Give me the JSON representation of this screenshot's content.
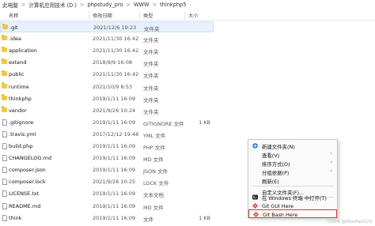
{
  "breadcrumb": [
    "此电脑",
    "计算机应用技术 (D:)",
    "phpstudy_pro",
    "WWW",
    "thinkphp5"
  ],
  "breadcrumb_sep": ">",
  "columns": {
    "name": "名称",
    "date": "修改日期",
    "type": "类型",
    "size": "大小"
  },
  "files": [
    {
      "name": ".git",
      "date": "2021/12/6 19:23",
      "type": "文件夹",
      "size": "",
      "icon": "folder-icon"
    },
    {
      "name": ".idea",
      "date": "2021/11/30 16:42",
      "type": "文件夹",
      "size": "",
      "icon": "folder-icon"
    },
    {
      "name": "application",
      "date": "2021/11/30 16:42",
      "type": "文件夹",
      "size": "",
      "icon": "folder-icon"
    },
    {
      "name": "extend",
      "date": "2018/9/9 16:08",
      "type": "文件夹",
      "size": "",
      "icon": "folder-icon"
    },
    {
      "name": "public",
      "date": "2021/11/30 16:42",
      "type": "文件夹",
      "size": "",
      "icon": "folder-icon"
    },
    {
      "name": "runtime",
      "date": "2021/10/9 8:53",
      "type": "文件夹",
      "size": "",
      "icon": "folder-icon"
    },
    {
      "name": "thinkphp",
      "date": "2019/1/11 16:09",
      "type": "文件夹",
      "size": "",
      "icon": "folder-icon"
    },
    {
      "name": "vendor",
      "date": "2021/9/26 10:24",
      "type": "文件夹",
      "size": "",
      "icon": "folder-icon"
    },
    {
      "name": ".gitignore",
      "date": "2019/1/11 16:09",
      "type": "GITIGNORE 文件",
      "size": "1 KB",
      "icon": "file-icon"
    },
    {
      "name": ".travis.yml",
      "date": "2017/12/12 19:48",
      "type": "YML 文件",
      "size": "",
      "icon": "file-icon"
    },
    {
      "name": "build.php",
      "date": "2019/1/11 16:09",
      "type": "PHP 文件",
      "size": "",
      "icon": "file-icon"
    },
    {
      "name": "CHANGELOG.md",
      "date": "2019/1/11 16:09",
      "type": "MD 文件",
      "size": "",
      "icon": "file-icon"
    },
    {
      "name": "composer.json",
      "date": "2019/1/11 16:09",
      "type": "JSON 文件",
      "size": "",
      "icon": "file-icon"
    },
    {
      "name": "composer.lock",
      "date": "2021/9/26 10:25",
      "type": "LOCK 文件",
      "size": "",
      "icon": "file-icon"
    },
    {
      "name": "LICENSE.txt",
      "date": "2019/1/11 16:09",
      "type": "文本文档",
      "size": "",
      "icon": "file-icon"
    },
    {
      "name": "README.md",
      "date": "2019/1/11 16:09",
      "type": "MD 文件",
      "size": "",
      "icon": "file-icon"
    },
    {
      "name": "think",
      "date": "2019/1/11 16:09",
      "type": "文件",
      "size": "1 KB",
      "icon": "file-icon"
    }
  ],
  "context_menu": [
    {
      "label": "新建文件夹(N)",
      "icon": "folder-plus-icon",
      "submenu": false
    },
    {
      "label": "查看(V)",
      "icon": "",
      "submenu": true
    },
    {
      "label": "排序方式(O)",
      "icon": "",
      "submenu": true
    },
    {
      "label": "分组依据(P)",
      "icon": "",
      "submenu": true
    },
    {
      "label": "刷新(E)",
      "icon": "",
      "submenu": false
    },
    {
      "label": "自定义文件夹(F)...",
      "icon": "",
      "submenu": false
    },
    {
      "label": "在 Windows 终端 中打开(T)",
      "icon": "terminal-icon",
      "submenu": false
    },
    {
      "label": "Git GUI Here",
      "icon": "git-gui-icon",
      "submenu": false
    },
    {
      "label": "Git Bash Here",
      "icon": "git-bash-icon",
      "submenu": false
    }
  ],
  "watermark": "CSDN @MissPan329",
  "colors": {
    "selection": "#e6f1fb",
    "highlight_border": "#d9363e",
    "folder": "#f5c842"
  }
}
